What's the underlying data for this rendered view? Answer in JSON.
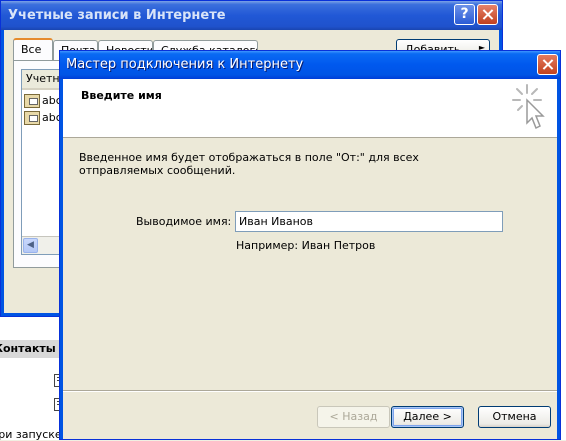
{
  "background": {
    "contacts_label": "Контакты",
    "footer_text": "При запуске"
  },
  "accounts_window": {
    "title": "Учетные записи в Интернете",
    "help_button": "?",
    "tabs": [
      {
        "label": "Все",
        "active": true
      },
      {
        "label": "Почта",
        "active": false
      },
      {
        "label": "Новости",
        "active": false
      },
      {
        "label": "Служба каталогов",
        "active": false
      }
    ],
    "add_button": "Добавить",
    "list": {
      "column_header": "Учетная запись",
      "rows": [
        {
          "label": "abc",
          "icon": "mail-account-icon"
        },
        {
          "label": "abc",
          "icon": "mail-account-icon"
        }
      ]
    }
  },
  "wizard": {
    "title": "Мастер подключения к Интернету",
    "header_title": "Введите имя",
    "header_icon": "wizard-sparkle-cursor-icon",
    "description": "Введенное имя будет отображаться в поле \"От:\" для всех отправляемых сообщений.",
    "name_label": "Выводимое имя:",
    "name_value": "Иван Иванов",
    "example": "Например: Иван Петров",
    "buttons": {
      "back": "< Назад",
      "next": "Далее >",
      "cancel": "Отмена"
    }
  },
  "colors": {
    "title_blue": "#0058ee",
    "inactive_title": "#2158d6",
    "close_red": "#c2421e",
    "dialog_face": "#ece9d8"
  }
}
